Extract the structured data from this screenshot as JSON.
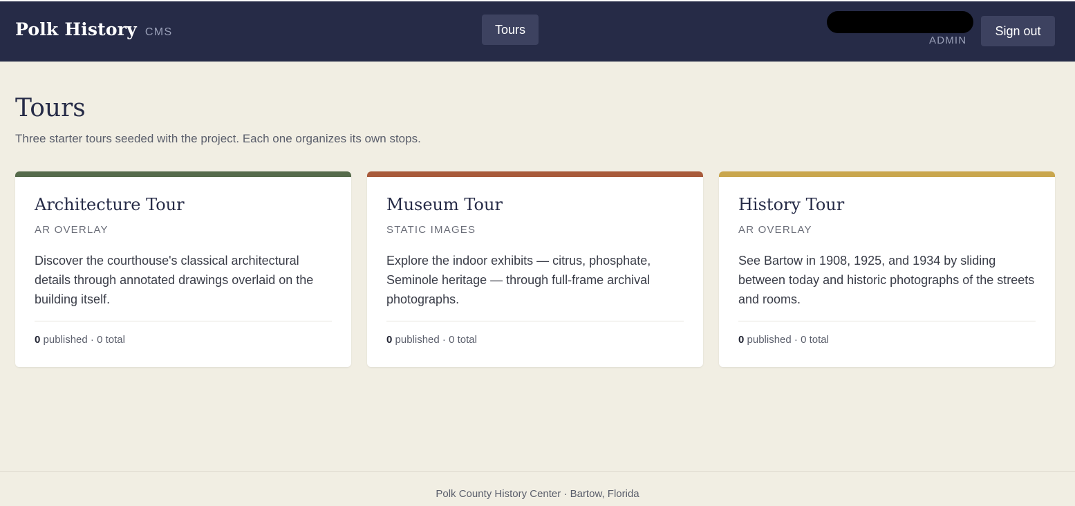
{
  "header": {
    "brand_name": "Polk History",
    "brand_sub": "CMS",
    "nav_tours": "Tours",
    "role": "ADMIN",
    "sign_out": "Sign out"
  },
  "page": {
    "title": "Tours",
    "subtitle": "Three starter tours seeded with the project. Each one organizes its own stops."
  },
  "tours": [
    {
      "title": "Architecture Tour",
      "type": "AR OVERLAY",
      "description": "Discover the courthouse's classical architectural details through annotated drawings overlaid on the building itself.",
      "published": "0",
      "published_label": " published · ",
      "total": "0 total",
      "accent": "#566b4b"
    },
    {
      "title": "Museum Tour",
      "type": "STATIC IMAGES",
      "description": "Explore the indoor exhibits — citrus, phosphate, Seminole heritage — through full-frame archival photographs.",
      "published": "0",
      "published_label": " published · ",
      "total": "0 total",
      "accent": "#a85a3a"
    },
    {
      "title": "History Tour",
      "type": "AR OVERLAY",
      "description": "See Bartow in 1908, 1925, and 1934 by sliding between today and historic photographs of the streets and rooms.",
      "published": "0",
      "published_label": " published · ",
      "total": "0 total",
      "accent": "#c9a64d"
    }
  ],
  "footer": {
    "text": "Polk County History Center · Bartow, Florida"
  },
  "colors": {
    "header_bg": "#262b47",
    "page_bg": "#f1eee3",
    "button_bg": "#3d4260"
  }
}
